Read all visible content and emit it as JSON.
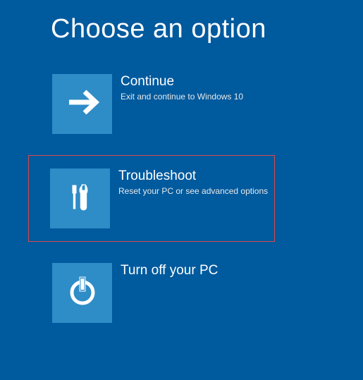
{
  "header": {
    "title": "Choose an option"
  },
  "options": {
    "continue": {
      "title": "Continue",
      "subtitle": "Exit and continue to Windows 10"
    },
    "troubleshoot": {
      "title": "Troubleshoot",
      "subtitle": "Reset your PC or see advanced options"
    },
    "turnoff": {
      "title": "Turn off your PC"
    }
  },
  "colors": {
    "background": "#005a9e",
    "tile": "#2e8cc7",
    "highlight_border": "#d94a4a"
  }
}
